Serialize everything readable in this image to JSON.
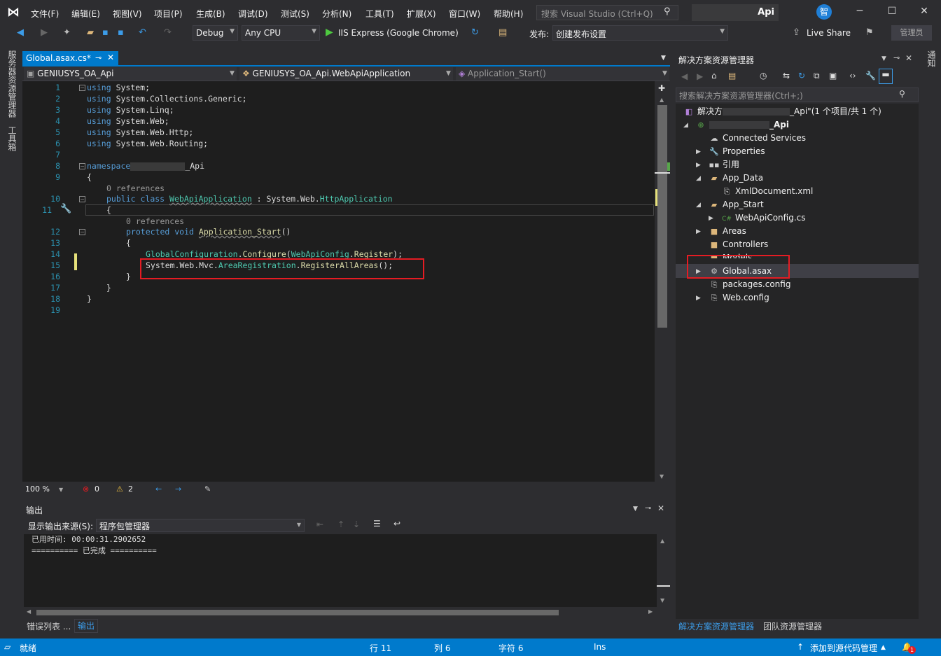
{
  "menubar": {
    "items": [
      "文件(F)",
      "编辑(E)",
      "视图(V)",
      "项目(P)",
      "生成(B)",
      "调试(D)",
      "测试(S)",
      "分析(N)",
      "工具(T)",
      "扩展(X)",
      "窗口(W)",
      "帮助(H)"
    ],
    "search_placeholder": "搜索 Visual Studio (Ctrl+Q)",
    "project_title": "Api",
    "avatar_label": "智"
  },
  "toolbar": {
    "configuration": "Debug",
    "platform": "Any CPU",
    "run_target": "IIS Express (Google Chrome)",
    "publish_label": "发布:",
    "publish_profile": "创建发布设置",
    "live_share": "Live Share",
    "admin": "管理员"
  },
  "left_strip": {
    "items": [
      "服务器资源管理器",
      "工具箱"
    ]
  },
  "right_strip": {
    "items": [
      "通知"
    ]
  },
  "document": {
    "tab_label": "Global.asax.cs*",
    "nav_project": "GENIUSYS_OA_Api",
    "nav_class": "GENIUSYS_OA_Api.WebApiApplication",
    "nav_member": "Application_Start()"
  },
  "code": {
    "line_numbers": [
      "1",
      "2",
      "3",
      "4",
      "5",
      "6",
      "7",
      "8",
      "9",
      "10",
      "11",
      "12",
      "13",
      "14",
      "15",
      "16",
      "17",
      "18",
      "19"
    ],
    "using_kw": "using",
    "usings": [
      "System;",
      "System.Collections.Generic;",
      "System.Linq;",
      "System.Web;",
      "System.Web.Http;",
      "System.Web.Routing;"
    ],
    "namespace_kw": "namespace",
    "namespace_name": "_Api",
    "open_brace": "{",
    "close_brace": "}",
    "refs_label": "0 references",
    "public_kw": "public",
    "class_kw": "class",
    "class_name": "WebApiApplication",
    "class_sep": " : ",
    "base_ns": "System.Web.",
    "base_type": "HttpApplication",
    "protected_kw": "protected",
    "void_kw": "void",
    "method_name": "Application_Start",
    "method_parens": "()",
    "l14_type1": "GlobalConfiguration",
    "l14_dot1": ".",
    "l14_fn": "Configure",
    "l14_open": "(",
    "l14_type2": "WebApiConfig",
    "l14_dot2": ".",
    "l14_arg": "Register",
    "l14_close": ");",
    "l15_ns": "System.Web.Mvc.",
    "l15_type": "AreaRegistration",
    "l15_dot": ".",
    "l15_fn": "RegisterAllAreas",
    "l15_end": "();"
  },
  "editor_status": {
    "zoom": "100 %",
    "errors": "0",
    "warnings": "2"
  },
  "output": {
    "title": "输出",
    "source_label": "显示输出来源(S):",
    "source_value": "程序包管理器",
    "lines": [
      "已用时间: 00:00:31.2902652",
      "========== 已完成 =========="
    ]
  },
  "bottom_tabs": [
    "错误列表 ...",
    "输出"
  ],
  "solution_explorer": {
    "title": "解决方案资源管理器",
    "search_placeholder": "搜索解决方案资源管理器(Ctrl+;)",
    "solution_label_prefix": "解决方",
    "solution_label_suffix": "_Api\"(1 个项目/共 1 个)",
    "project_name": "_Api",
    "items": {
      "connected": "Connected Services",
      "properties": "Properties",
      "references": "引用",
      "app_data": "App_Data",
      "xmldoc": "XmlDocument.xml",
      "app_start": "App_Start",
      "webapiconfig": "WebApiConfig.cs",
      "areas": "Areas",
      "controllers": "Controllers",
      "models": "Models",
      "global": "Global.asax",
      "packages": "packages.config",
      "webconfig": "Web.config"
    },
    "bottom_tabs": [
      "解决方案资源管理器",
      "团队资源管理器"
    ]
  },
  "statusbar": {
    "ready": "就绪",
    "line": "行 11",
    "col": "列 6",
    "char": "字符 6",
    "ins": "Ins",
    "source_control": "添加到源代码管理",
    "notif_count": "1"
  },
  "colors": {
    "accent": "#007acc",
    "highlight_red": "#e51c23",
    "keyword": "#569cd6",
    "type": "#4ec9b0"
  }
}
